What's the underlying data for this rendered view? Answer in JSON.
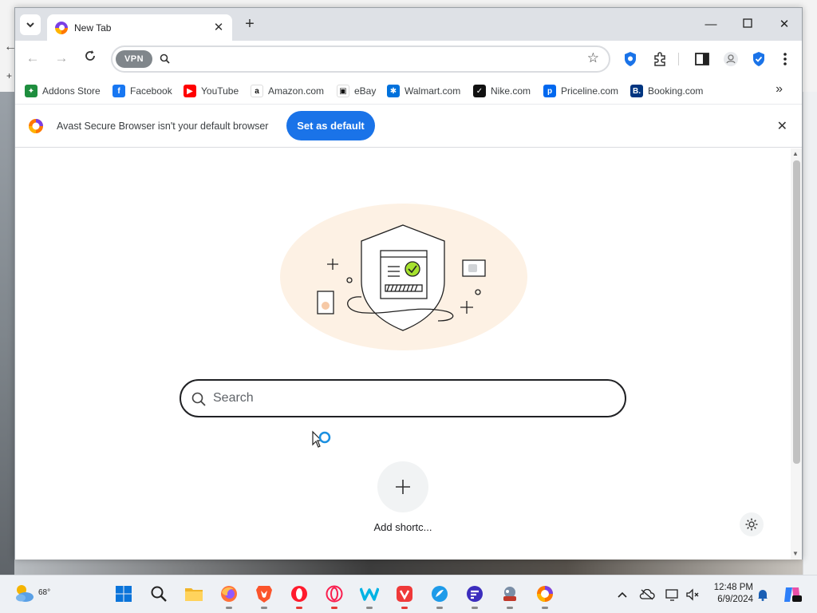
{
  "browser": {
    "tab": {
      "title": "New Tab"
    },
    "omnibox": {
      "vpn_label": "VPN",
      "value": ""
    },
    "bookmarks": [
      {
        "label": "Addons Store",
        "icon": "addons-store-icon",
        "color": "#1e8e3e",
        "glyph": "✦"
      },
      {
        "label": "Facebook",
        "icon": "facebook-icon",
        "color": "#1877f2",
        "glyph": "f"
      },
      {
        "label": "YouTube",
        "icon": "youtube-icon",
        "color": "#ff0000",
        "glyph": "▶"
      },
      {
        "label": "Amazon.com",
        "icon": "amazon-icon",
        "color": "#ffffff",
        "glyph": "a"
      },
      {
        "label": "eBay",
        "icon": "ebay-icon",
        "color": "#ffffff",
        "glyph": "▣"
      },
      {
        "label": "Walmart.com",
        "icon": "walmart-icon",
        "color": "#0071dc",
        "glyph": "✱"
      },
      {
        "label": "Nike.com",
        "icon": "nike-icon",
        "color": "#111111",
        "glyph": "✓"
      },
      {
        "label": "Priceline.com",
        "icon": "priceline-icon",
        "color": "#0068ef",
        "glyph": "p"
      },
      {
        "label": "Booking.com",
        "icon": "booking-icon",
        "color": "#003580",
        "glyph": "B."
      }
    ],
    "infobar": {
      "message": "Avast Secure Browser isn't your default browser",
      "button_label": "Set as default"
    },
    "ntp": {
      "search_placeholder": "Search",
      "shortcut_label": "Add shortc..."
    }
  },
  "taskbar": {
    "weather_temp": "68°",
    "time": "12:48 PM",
    "date": "6/9/2024",
    "apps": [
      "windows-start-icon",
      "search-icon",
      "file-explorer-icon",
      "firefox-icon",
      "brave-icon",
      "opera-icon",
      "opera-gx-icon",
      "wave-browser-icon",
      "vivaldi-icon",
      "maxthon-icon",
      "floorp-icon",
      "lunascape-icon",
      "avast-secure-browser-icon"
    ]
  },
  "colors": {
    "accent": "#1a73e8",
    "tab_strip": "#dee1e6",
    "illustration_glow": "#fdf1e4",
    "check_green": "#a6e22e"
  }
}
